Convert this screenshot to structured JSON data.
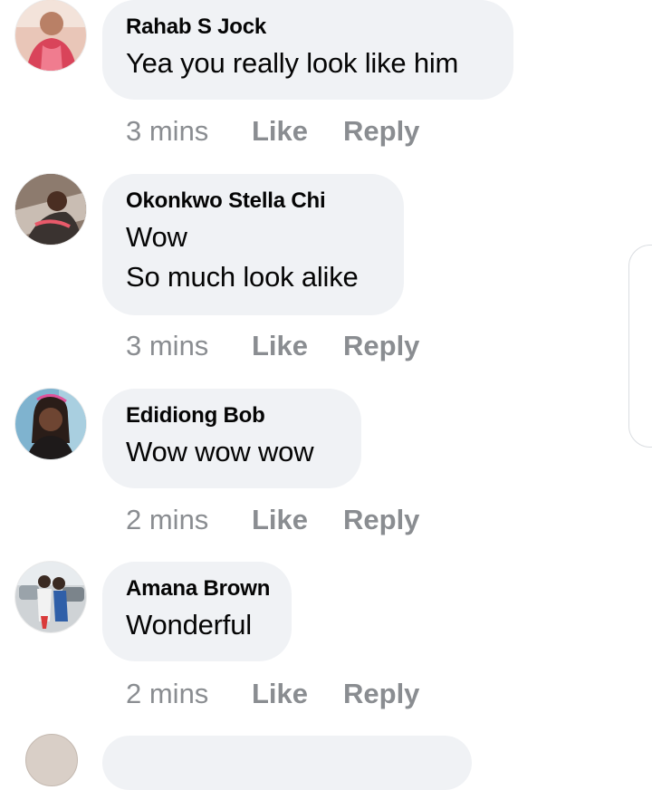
{
  "comments": [
    {
      "author": "Rahab S Jock",
      "text": "Yea you really look like him",
      "time": "3 mins",
      "like_label": "Like",
      "reply_label": "Reply"
    },
    {
      "author": "Okonkwo Stella Chi",
      "text": "Wow\nSo much look alike",
      "time": "3 mins",
      "like_label": "Like",
      "reply_label": "Reply"
    },
    {
      "author": "Edidiong Bob",
      "text": "Wow wow wow",
      "time": "2 mins",
      "like_label": "Like",
      "reply_label": "Reply"
    },
    {
      "author": "Amana Brown",
      "text": "Wonderful",
      "time": "2 mins",
      "like_label": "Like",
      "reply_label": "Reply"
    }
  ],
  "colors": {
    "bubble": "#f0f2f5",
    "meta_text": "#8a8d91",
    "primary_text": "#050505"
  }
}
